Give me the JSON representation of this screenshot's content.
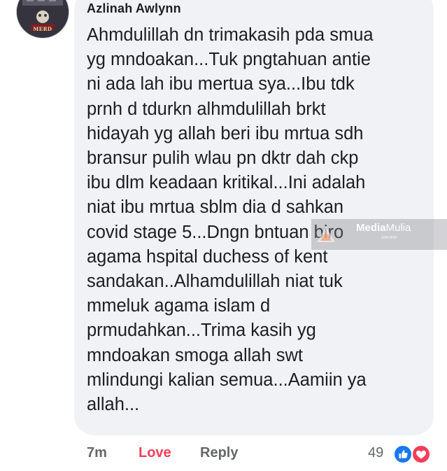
{
  "comment": {
    "author": "Azlinah Awlynn",
    "lines": [
      "Ahmdulillah dn trimakasih pda smua",
      "yg mndoakan...Tuk pngtahuan antie",
      "ni ada lah ibu mertua sya...Ibu tdk",
      "prnh d tdurkn alhmdulillah brkt",
      "hidayah yg allah beri ibu mrtua sdh",
      "bransur pulih wlau pn dktr dah ckp",
      "ibu dlm keadaan kritikal...Ini adalah",
      "niat ibu mrtua sblm dia d sahkan",
      "covid stage 5...Dngn bntuan biro",
      "agama hspital duchess of kent",
      "sandakan..Alhamdulillah niat tuk",
      "mmeluk agama islam d",
      "prmudahkan...Trima kasih yg",
      "mndoakan smoga allah swt",
      "mlindungi kalian semua...Aamiin ya",
      "allah..."
    ],
    "avatar_badge": "MERD"
  },
  "actions": {
    "time": "7m",
    "love": "Love",
    "reply": "Reply"
  },
  "reactions": {
    "count": "49",
    "icons": [
      "like-icon",
      "heart-icon"
    ]
  },
  "watermark": {
    "brand_bold": "Media",
    "brand_light": "Mulia",
    "tagline": "SDN BHD"
  },
  "colors": {
    "bubble": "#f0f2f5",
    "love_red": "#f33e58",
    "like_blue": "#1877f2",
    "muted": "#65676b",
    "text": "#1c1e21"
  }
}
